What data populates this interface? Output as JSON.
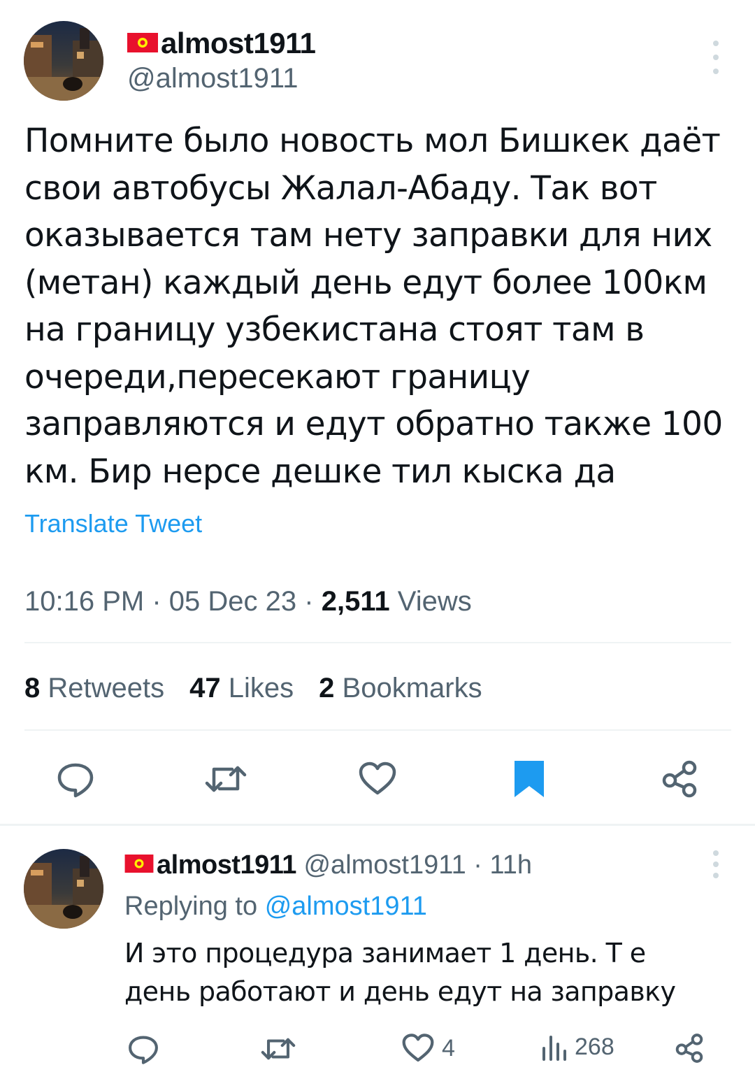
{
  "main_tweet": {
    "display_name": "almost1911",
    "handle": "@almost1911",
    "text": "Помните было новость мол Бишкек даёт свои автобусы Жалал-Абаду. Так вот оказывается там нету заправки для них (метан) каждый день едут более 100км на границу узбекистана стоят там в очереди,пересекают границу заправляются и едут обратно также 100 км. Бир нерсе дешке тил кыска да",
    "translate_label": "Translate Tweet",
    "time": "10:16 PM",
    "date": "05 Dec 23",
    "separator": "·",
    "views_count": "2,511",
    "views_label": "Views",
    "retweets_count": "8",
    "retweets_label": "Retweets",
    "likes_count": "47",
    "likes_label": "Likes",
    "bookmarks_count": "2",
    "bookmarks_label": "Bookmarks",
    "bookmarked": true
  },
  "reply": {
    "display_name": "almost1911",
    "handle": "@almost1911",
    "separator": "·",
    "time_ago": "11h",
    "replying_label": "Replying to",
    "replying_to": "@almost1911",
    "text": "И это процедура занимает 1 день. Т е день работают и день едут на заправку",
    "likes_count": "4",
    "views_count": "268"
  },
  "icons": {
    "flag": "kyrgyzstan-flag-icon",
    "more": "more-vertical-icon",
    "reply": "reply-icon",
    "retweet": "retweet-icon",
    "like": "heart-icon",
    "bookmark": "bookmark-icon",
    "share": "share-icon",
    "views": "views-icon"
  },
  "colors": {
    "text": "#0f1419",
    "secondary": "#536471",
    "link": "#1d9bf0",
    "divider": "#eff3f4",
    "flag_red": "#e8112d",
    "flag_sun": "#ffef00"
  }
}
